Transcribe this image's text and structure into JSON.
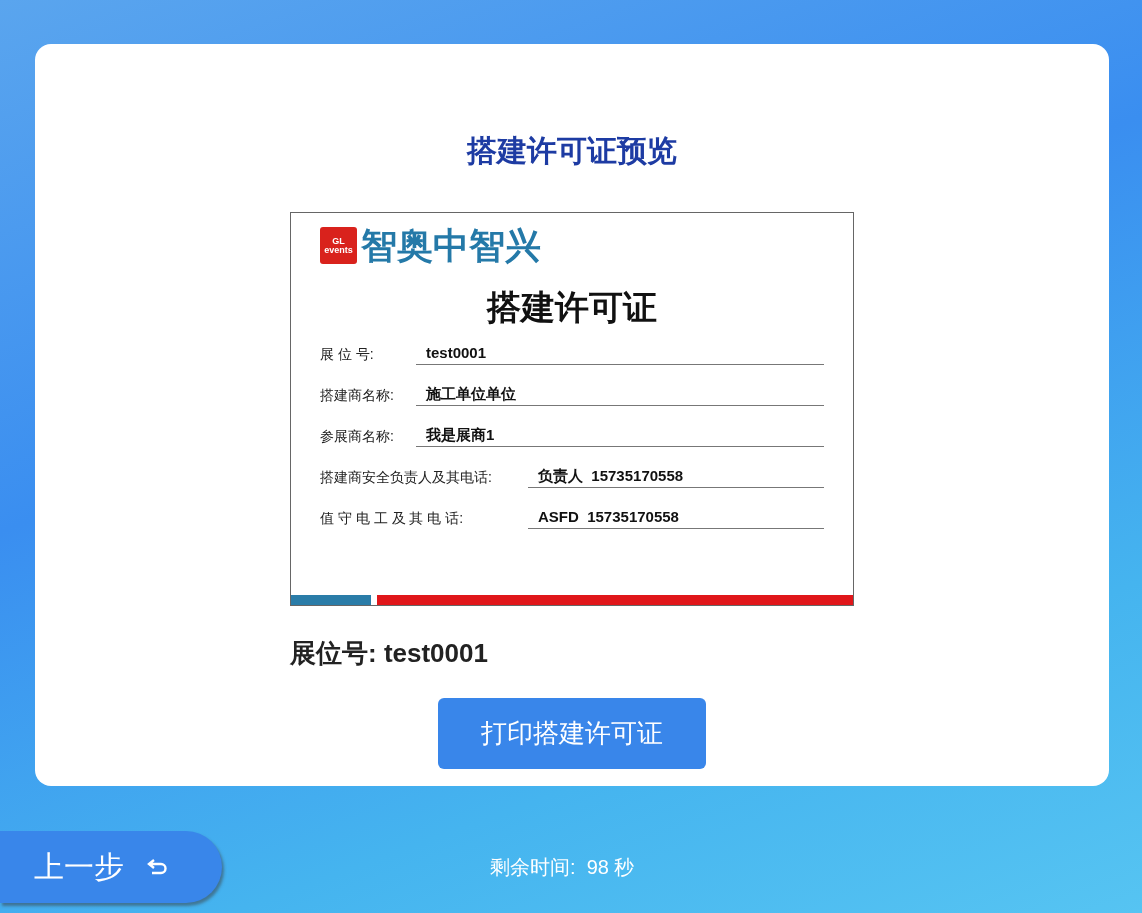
{
  "page_title": "搭建许可证预览",
  "certificate": {
    "logo_badge": "GL events",
    "logo_text": "智奥中智兴",
    "title": "搭建许可证",
    "fields": [
      {
        "label": "展 位 号:",
        "value": "test0001",
        "kind": "short"
      },
      {
        "label": "搭建商名称:",
        "value": "施工单位单位",
        "kind": "short"
      },
      {
        "label": "参展商名称:",
        "value": "我是展商1",
        "kind": "short"
      },
      {
        "label": "搭建商安全负责人及其电话:",
        "value": "负责人  15735170558",
        "kind": "long"
      },
      {
        "label": "值 守 电 工 及 其 电 话:",
        "value": "ASFD  15735170558",
        "kind": "long"
      }
    ]
  },
  "booth_number": "展位号: test0001",
  "print_button": "打印搭建许可证",
  "back_button": "上一步",
  "countdown": "剩余时间:  98 秒"
}
